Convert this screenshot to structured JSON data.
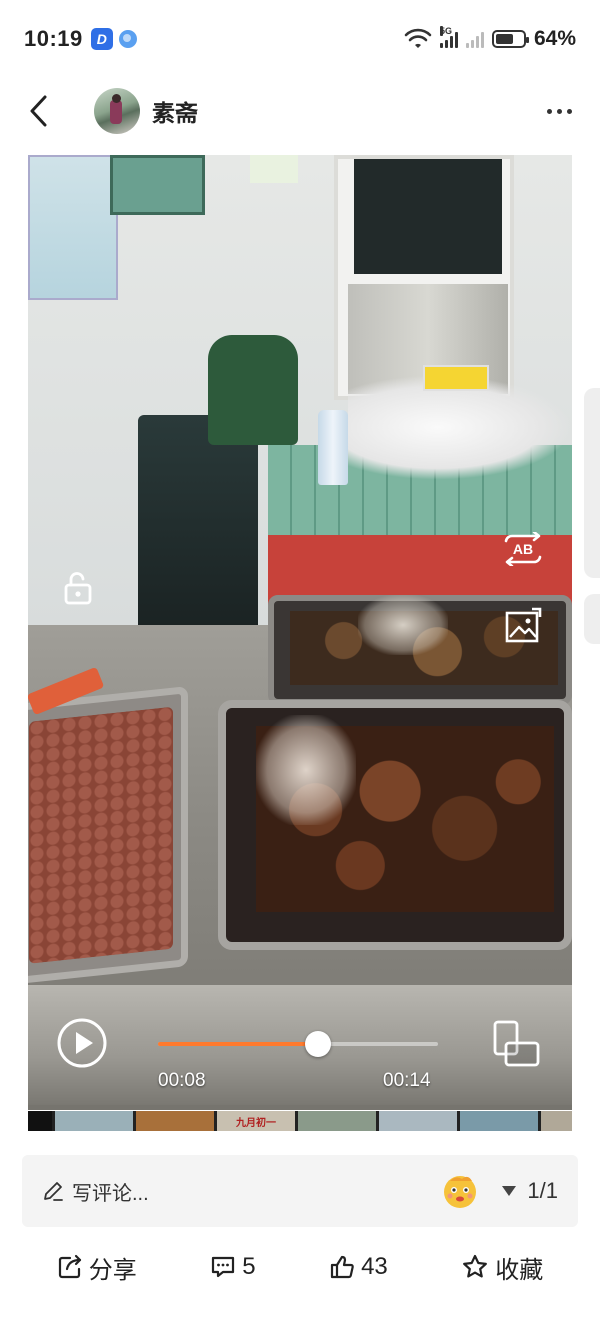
{
  "status_bar": {
    "time": "10:19",
    "app_badge_letter": "D",
    "battery_level": 0.64,
    "battery_text": "64%",
    "signal_label": "5G"
  },
  "header": {
    "username": "素斋",
    "back_icon": "chevron-left-icon",
    "more_icon": "more-horizontal-icon"
  },
  "player": {
    "current_time": "00:08",
    "total_time": "00:14",
    "progress": 0.57,
    "accent_color": "#ff7a2e",
    "ab_label": "AB"
  },
  "thumbnail_strip": {
    "thumbs": [
      {
        "color": "#9ab0b8"
      },
      {
        "color": "#a8703a"
      },
      {
        "color": "#c8c0b0",
        "label": "九月初一"
      },
      {
        "color": "#8a9a8a"
      },
      {
        "color": "#aab8c0"
      },
      {
        "color": "#7a9aa8"
      },
      {
        "color": "#b0a898"
      }
    ]
  },
  "comment_bar": {
    "placeholder": "写评论...",
    "page": "1/1"
  },
  "actions": {
    "share_label": "分享",
    "comment_count": "5",
    "like_count": "43",
    "favorite_label": "收藏"
  }
}
